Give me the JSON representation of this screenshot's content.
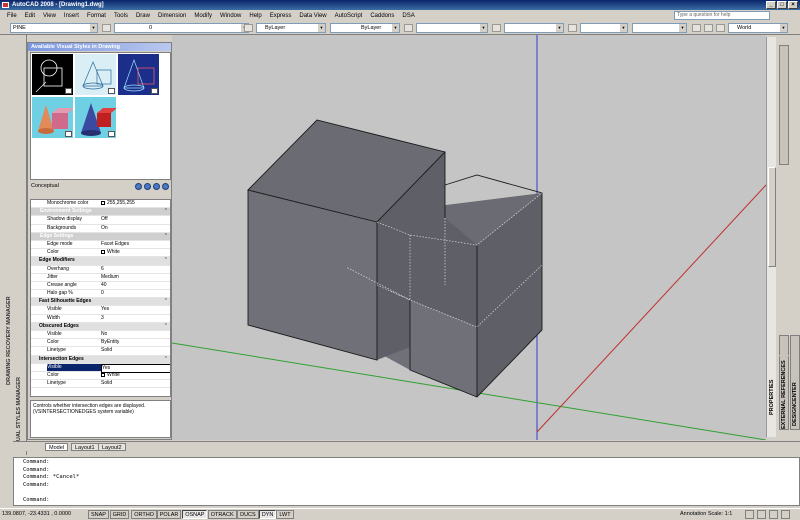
{
  "window": {
    "title": "AutoCAD 2008 - [Drawing1.dwg]",
    "controls": [
      "_",
      "□",
      "×"
    ]
  },
  "menu": {
    "items": [
      "File",
      "Edit",
      "View",
      "Insert",
      "Format",
      "Tools",
      "Draw",
      "Dimension",
      "Modify",
      "Window",
      "Help",
      "Express",
      "Data View",
      "AutoScript",
      "Caddons",
      "DSA"
    ],
    "help_placeholder": "Type a question for help"
  },
  "toolbar": {
    "workspace": "PINE",
    "layer": "0",
    "color": "ByLayer",
    "linetype": "ByLayer",
    "lineweight": "",
    "plotstyle": "",
    "ucs": "World"
  },
  "left_strip": {
    "upper": "DRAWING RECOVERY MANAGER",
    "lower": "VISUAL STYLES MANAGER"
  },
  "palette": {
    "header": "Available Visual Styles in Drawing",
    "current_style": "Conceptual",
    "properties": [
      {
        "kind": "row",
        "key": "Monochrome color",
        "value": "255,255,255",
        "swatch": "#ffffff"
      },
      {
        "kind": "sec",
        "key": "Environment Settings"
      },
      {
        "kind": "row",
        "key": "Shadow display",
        "value": "Off"
      },
      {
        "kind": "row",
        "key": "Backgrounds",
        "value": "On"
      },
      {
        "kind": "sec",
        "key": "Edge Settings"
      },
      {
        "kind": "row",
        "key": "Edge mode",
        "value": "Facet Edges"
      },
      {
        "kind": "row",
        "key": "Color",
        "value": "White",
        "swatch": "#ffffff"
      },
      {
        "kind": "cat",
        "key": "Edge Modifiers"
      },
      {
        "kind": "row",
        "key": "Overhang",
        "value": "6"
      },
      {
        "kind": "row",
        "key": "Jitter",
        "value": "Medium"
      },
      {
        "kind": "row",
        "key": "Crease angle",
        "value": "40"
      },
      {
        "kind": "row",
        "key": "Halo gap %",
        "value": "0"
      },
      {
        "kind": "cat",
        "key": "Fast Silhouette Edges"
      },
      {
        "kind": "row",
        "key": "Visible",
        "value": "Yes"
      },
      {
        "kind": "row",
        "key": "Width",
        "value": "3"
      },
      {
        "kind": "cat",
        "key": "Obscured Edges"
      },
      {
        "kind": "row",
        "key": "Visible",
        "value": "No"
      },
      {
        "kind": "row",
        "key": "Color",
        "value": "ByEntity"
      },
      {
        "kind": "row",
        "key": "Linetype",
        "value": "Solid"
      },
      {
        "kind": "cat",
        "key": "Intersection Edges"
      },
      {
        "kind": "sel",
        "key": "Visible",
        "value": "Yes"
      },
      {
        "kind": "row",
        "key": "Color",
        "value": "White",
        "swatch": "#ffffff"
      },
      {
        "kind": "row",
        "key": "Linetype",
        "value": "Solid"
      }
    ],
    "description": "Controls whether intersection edges are displayed. (VSINTERSECTIONEDGES system variable)"
  },
  "right_tabs": [
    "DESIGNCENTER",
    "EXTERNAL REFERENCES",
    "PROPERTIES"
  ],
  "layout_tabs": [
    "Model",
    "Layout1",
    "Layout2"
  ],
  "command_lines": [
    "Command:",
    "Command:",
    "Command: *Cancel*",
    "Command:",
    "",
    "Command:"
  ],
  "status": {
    "coords": "139.0807, -23.4331 , 0.0000",
    "toggles": [
      {
        "label": "SNAP",
        "on": false
      },
      {
        "label": "GRID",
        "on": false
      },
      {
        "label": "ORTHO",
        "on": false
      },
      {
        "label": "POLAR",
        "on": false
      },
      {
        "label": "OSNAP",
        "on": true
      },
      {
        "label": "OTRACK",
        "on": false
      },
      {
        "label": "DUCS",
        "on": false
      },
      {
        "label": "DYN",
        "on": true
      },
      {
        "label": "LWT",
        "on": false
      }
    ],
    "annotation_scale": "Annotation Scale:  1:1"
  },
  "colors": {
    "face_front": "#707078",
    "face_top": "#6b6b73",
    "face_side": "#5f5f67",
    "axis_y": "#3040d0",
    "axis_x": "#c03030",
    "axis_z": "#30a030"
  }
}
